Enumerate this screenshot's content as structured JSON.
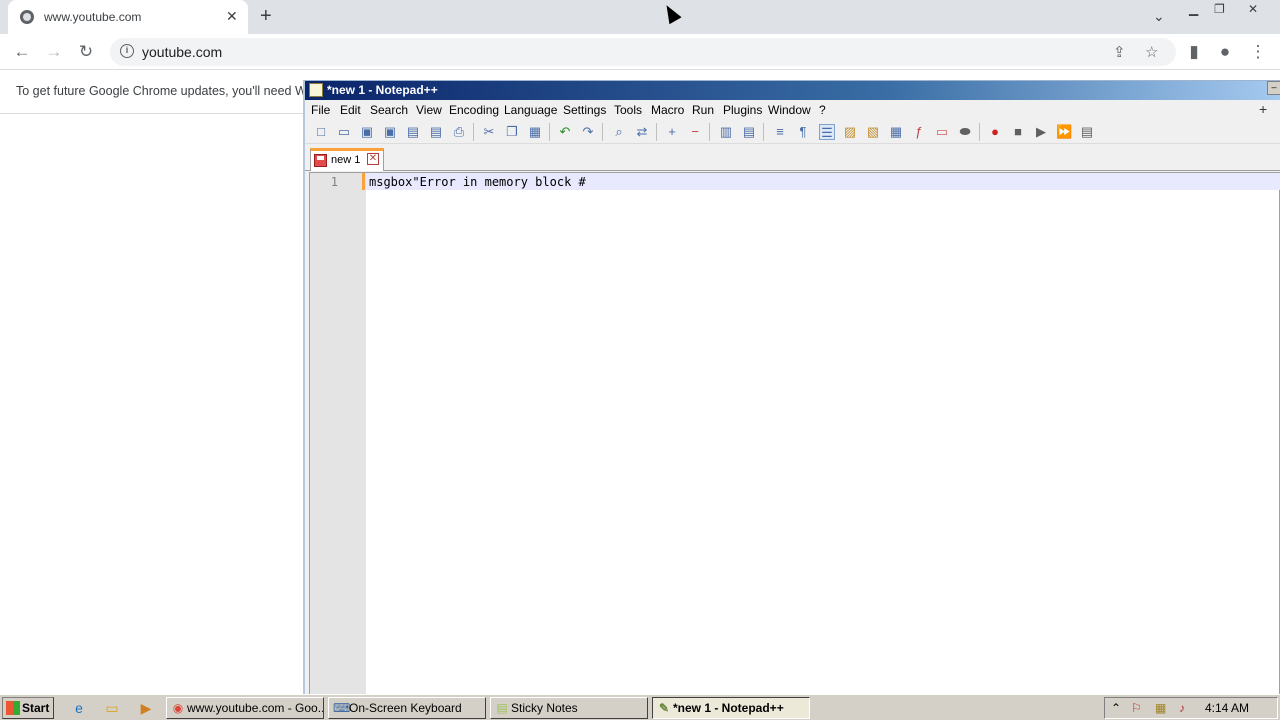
{
  "chrome": {
    "tab_title": "www.youtube.com",
    "tab_close": "✕",
    "new_tab": "+",
    "url": "youtube.com",
    "infobar_text": "To get future Google Chrome updates, you'll need Win"
  },
  "npp": {
    "title": "*new 1 - Notepad++",
    "menu": [
      "File",
      "Edit",
      "Search",
      "View",
      "Encoding",
      "Language",
      "Settings",
      "Tools",
      "Macro",
      "Run",
      "Plugins",
      "Window",
      "?"
    ],
    "menu_plus": "+",
    "tab_label": "new 1",
    "line_number": "1",
    "code_line": "msgbox\"Error in memory block #"
  },
  "taskbar": {
    "start": "Start",
    "tasks": [
      {
        "label": "www.youtube.com - Goo...",
        "icon": "chrome-icon"
      },
      {
        "label": "On-Screen Keyboard",
        "icon": "keyboard-icon"
      },
      {
        "label": "Sticky Notes",
        "icon": "sticky-notes-icon"
      },
      {
        "label": "*new 1 - Notepad++",
        "icon": "notepad-icon"
      }
    ],
    "clock": "4:14 AM"
  }
}
